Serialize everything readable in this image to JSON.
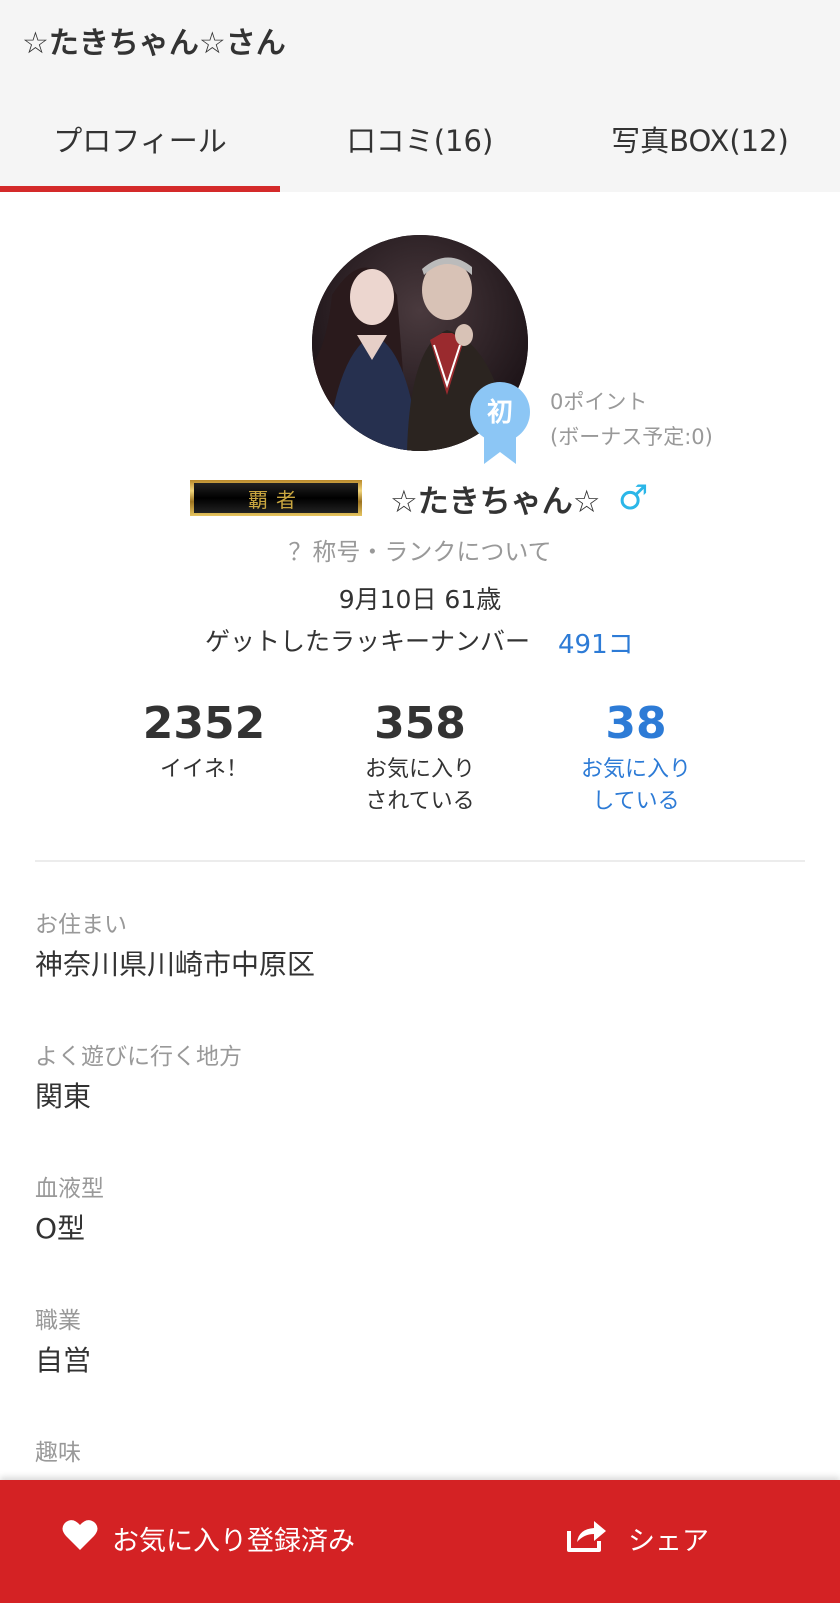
{
  "header": {
    "title": "☆たきちゃん☆さん",
    "tabs": [
      {
        "label": "プロフィール",
        "active": true
      },
      {
        "label": "口コミ(16)",
        "active": false
      },
      {
        "label": "写真BOX(12)",
        "active": false
      }
    ]
  },
  "profile": {
    "badge": "初",
    "points": "0ポイント",
    "bonus": "(ボーナス予定:0)",
    "rank_plate_text": "覇者",
    "name": "☆たきちゃん☆",
    "gender_symbol": "♂",
    "rank_help": "？称号・ランクについて",
    "birthday": "9月10日 61歳",
    "lucky_label": "ゲットしたラッキーナンバー",
    "lucky_value": "491コ"
  },
  "stats": [
    {
      "value": "2352",
      "label_line1": "イイネ！",
      "label_line2": ""
    },
    {
      "value": "358",
      "label_line1": "お気に入り",
      "label_line2": "されている"
    },
    {
      "value": "38",
      "label_line1": "お気に入り",
      "label_line2": "している"
    }
  ],
  "fields": [
    {
      "label": "お住まい",
      "value": "神奈川県川崎市中原区"
    },
    {
      "label": "よく遊びに行く地方",
      "value": "関東"
    },
    {
      "label": "血液型",
      "value": "O型"
    },
    {
      "label": "職業",
      "value": "自営"
    },
    {
      "label": "趣味",
      "value": ""
    }
  ],
  "bottom_bar": {
    "favorite_label": "お気に入り登録済み",
    "share_label": "シェア"
  },
  "colors": {
    "accent_red": "#d42224",
    "link_blue": "#2d7bd6",
    "badge_blue": "#8cc6f5",
    "male_blue": "#2bb6e8"
  }
}
